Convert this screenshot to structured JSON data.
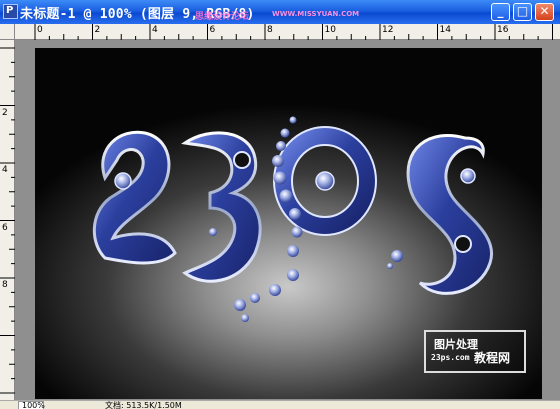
{
  "window": {
    "title": "未标题-1 @ 100% (图层 9, RGB/8)",
    "watermark": "思缘设计论坛",
    "watermark_url": "WWW.MISSYUAN.COM",
    "buttons": {
      "minimize": "_",
      "maximize": "□",
      "close": "✕"
    },
    "accent_color": "#0a4ad0",
    "close_color": "#d4411e"
  },
  "ruler": {
    "top_labels": [
      "0",
      "2",
      "4",
      "6",
      "8",
      "10",
      "12",
      "14",
      "16"
    ],
    "left_labels": [
      "2",
      "4",
      "6",
      "8"
    ]
  },
  "canvas": {
    "artwork_text": "23OS",
    "background": "black-to-gray radial gradient",
    "letter_color": "#2b3f9e"
  },
  "logo": {
    "line1": "图片处理",
    "line2": "23ps.com",
    "line3": "教程网"
  },
  "statusbar": {
    "zoom": "100%",
    "info": "文档: 513.5K/1.50M"
  },
  "icons": {
    "app": "photoshop-document-icon",
    "minimize": "minimize-icon",
    "maximize": "maximize-icon",
    "close": "close-icon"
  }
}
